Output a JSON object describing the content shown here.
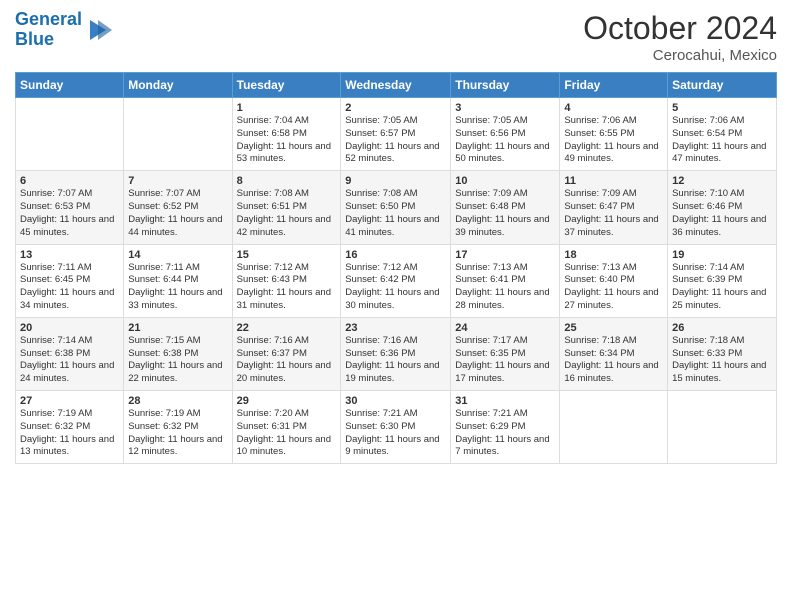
{
  "header": {
    "logo_line1": "General",
    "logo_line2": "Blue",
    "month": "October 2024",
    "location": "Cerocahui, Mexico"
  },
  "weekdays": [
    "Sunday",
    "Monday",
    "Tuesday",
    "Wednesday",
    "Thursday",
    "Friday",
    "Saturday"
  ],
  "weeks": [
    [
      {
        "day": "",
        "info": ""
      },
      {
        "day": "",
        "info": ""
      },
      {
        "day": "1",
        "info": "Sunrise: 7:04 AM\nSunset: 6:58 PM\nDaylight: 11 hours and 53 minutes."
      },
      {
        "day": "2",
        "info": "Sunrise: 7:05 AM\nSunset: 6:57 PM\nDaylight: 11 hours and 52 minutes."
      },
      {
        "day": "3",
        "info": "Sunrise: 7:05 AM\nSunset: 6:56 PM\nDaylight: 11 hours and 50 minutes."
      },
      {
        "day": "4",
        "info": "Sunrise: 7:06 AM\nSunset: 6:55 PM\nDaylight: 11 hours and 49 minutes."
      },
      {
        "day": "5",
        "info": "Sunrise: 7:06 AM\nSunset: 6:54 PM\nDaylight: 11 hours and 47 minutes."
      }
    ],
    [
      {
        "day": "6",
        "info": "Sunrise: 7:07 AM\nSunset: 6:53 PM\nDaylight: 11 hours and 45 minutes."
      },
      {
        "day": "7",
        "info": "Sunrise: 7:07 AM\nSunset: 6:52 PM\nDaylight: 11 hours and 44 minutes."
      },
      {
        "day": "8",
        "info": "Sunrise: 7:08 AM\nSunset: 6:51 PM\nDaylight: 11 hours and 42 minutes."
      },
      {
        "day": "9",
        "info": "Sunrise: 7:08 AM\nSunset: 6:50 PM\nDaylight: 11 hours and 41 minutes."
      },
      {
        "day": "10",
        "info": "Sunrise: 7:09 AM\nSunset: 6:48 PM\nDaylight: 11 hours and 39 minutes."
      },
      {
        "day": "11",
        "info": "Sunrise: 7:09 AM\nSunset: 6:47 PM\nDaylight: 11 hours and 37 minutes."
      },
      {
        "day": "12",
        "info": "Sunrise: 7:10 AM\nSunset: 6:46 PM\nDaylight: 11 hours and 36 minutes."
      }
    ],
    [
      {
        "day": "13",
        "info": "Sunrise: 7:11 AM\nSunset: 6:45 PM\nDaylight: 11 hours and 34 minutes."
      },
      {
        "day": "14",
        "info": "Sunrise: 7:11 AM\nSunset: 6:44 PM\nDaylight: 11 hours and 33 minutes."
      },
      {
        "day": "15",
        "info": "Sunrise: 7:12 AM\nSunset: 6:43 PM\nDaylight: 11 hours and 31 minutes."
      },
      {
        "day": "16",
        "info": "Sunrise: 7:12 AM\nSunset: 6:42 PM\nDaylight: 11 hours and 30 minutes."
      },
      {
        "day": "17",
        "info": "Sunrise: 7:13 AM\nSunset: 6:41 PM\nDaylight: 11 hours and 28 minutes."
      },
      {
        "day": "18",
        "info": "Sunrise: 7:13 AM\nSunset: 6:40 PM\nDaylight: 11 hours and 27 minutes."
      },
      {
        "day": "19",
        "info": "Sunrise: 7:14 AM\nSunset: 6:39 PM\nDaylight: 11 hours and 25 minutes."
      }
    ],
    [
      {
        "day": "20",
        "info": "Sunrise: 7:14 AM\nSunset: 6:38 PM\nDaylight: 11 hours and 24 minutes."
      },
      {
        "day": "21",
        "info": "Sunrise: 7:15 AM\nSunset: 6:38 PM\nDaylight: 11 hours and 22 minutes."
      },
      {
        "day": "22",
        "info": "Sunrise: 7:16 AM\nSunset: 6:37 PM\nDaylight: 11 hours and 20 minutes."
      },
      {
        "day": "23",
        "info": "Sunrise: 7:16 AM\nSunset: 6:36 PM\nDaylight: 11 hours and 19 minutes."
      },
      {
        "day": "24",
        "info": "Sunrise: 7:17 AM\nSunset: 6:35 PM\nDaylight: 11 hours and 17 minutes."
      },
      {
        "day": "25",
        "info": "Sunrise: 7:18 AM\nSunset: 6:34 PM\nDaylight: 11 hours and 16 minutes."
      },
      {
        "day": "26",
        "info": "Sunrise: 7:18 AM\nSunset: 6:33 PM\nDaylight: 11 hours and 15 minutes."
      }
    ],
    [
      {
        "day": "27",
        "info": "Sunrise: 7:19 AM\nSunset: 6:32 PM\nDaylight: 11 hours and 13 minutes."
      },
      {
        "day": "28",
        "info": "Sunrise: 7:19 AM\nSunset: 6:32 PM\nDaylight: 11 hours and 12 minutes."
      },
      {
        "day": "29",
        "info": "Sunrise: 7:20 AM\nSunset: 6:31 PM\nDaylight: 11 hours and 10 minutes."
      },
      {
        "day": "30",
        "info": "Sunrise: 7:21 AM\nSunset: 6:30 PM\nDaylight: 11 hours and 9 minutes."
      },
      {
        "day": "31",
        "info": "Sunrise: 7:21 AM\nSunset: 6:29 PM\nDaylight: 11 hours and 7 minutes."
      },
      {
        "day": "",
        "info": ""
      },
      {
        "day": "",
        "info": ""
      }
    ]
  ]
}
